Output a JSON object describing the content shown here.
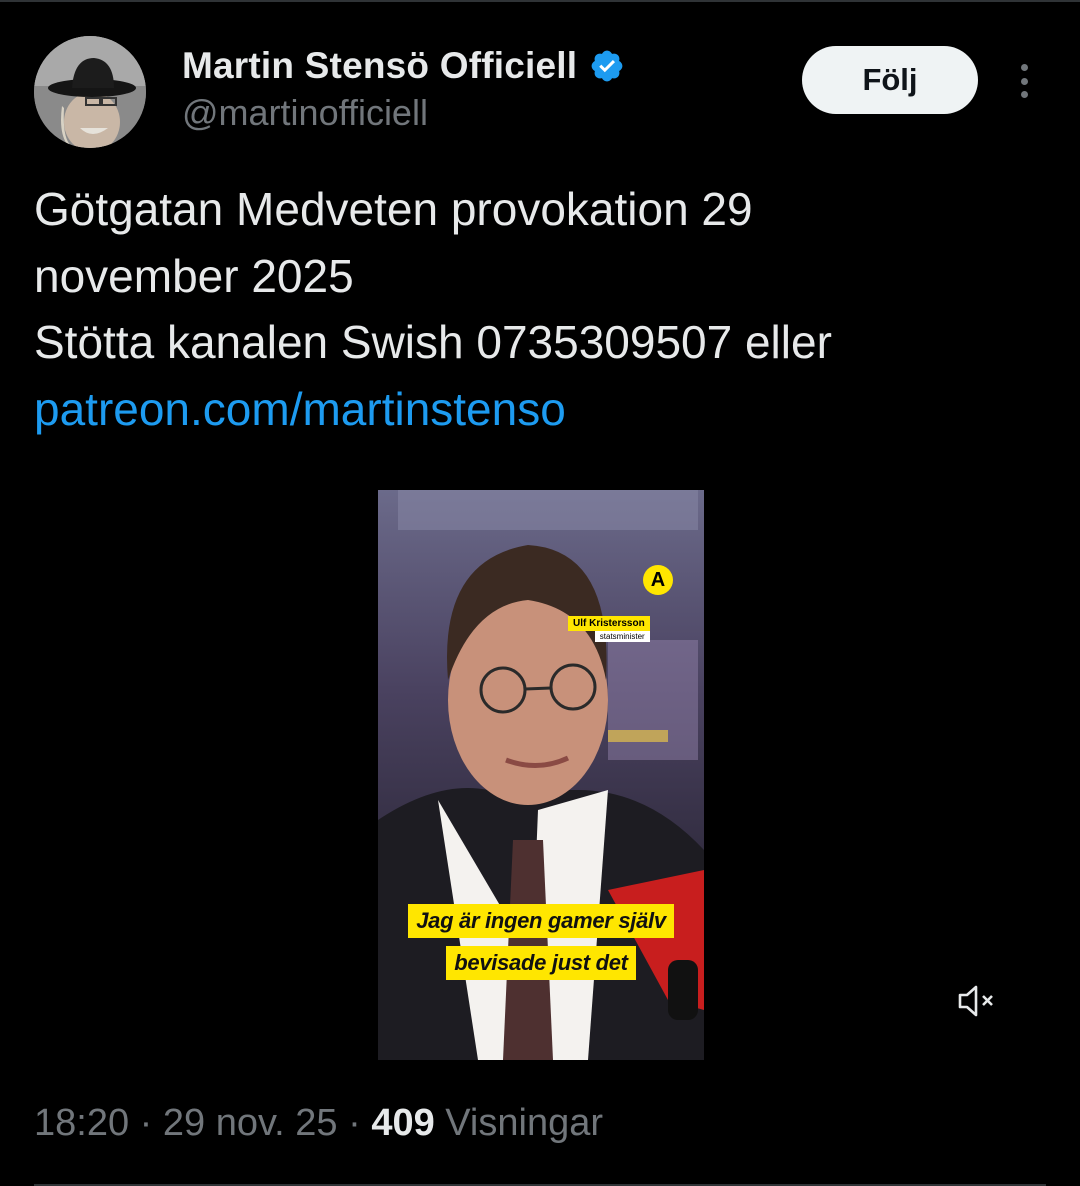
{
  "author": {
    "display_name": "Martin Stensö Officiell",
    "handle": "@martinofficiell",
    "verified": true,
    "avatar_icon": "profile-photo"
  },
  "actions": {
    "follow_label": "Följ",
    "more_icon": "more-vertical-icon"
  },
  "tweet": {
    "text": "Götgatan  Medveten provokation 29\nnovember 2025\nStötta kanalen Swish 0735309507 eller\n",
    "link": "patreon.com/martinstenso"
  },
  "media": {
    "logo": "A",
    "name_tag": "Ulf Kristersson",
    "name_title": "statsminister",
    "caption_line1": "Jag är ingen gamer själv",
    "caption_line2": "bevisade just det",
    "mute_icon": "mute-icon"
  },
  "meta": {
    "time": "18:20",
    "sep1": " · ",
    "date": "29 nov. 25",
    "sep2": " · ",
    "views_count": "409",
    "views_label": " Visningar"
  },
  "colors": {
    "background": "#000000",
    "link": "#1d9bf0",
    "verified": "#1d9bf0",
    "muted_text": "#71767b",
    "caption_bg": "#ffe600"
  }
}
